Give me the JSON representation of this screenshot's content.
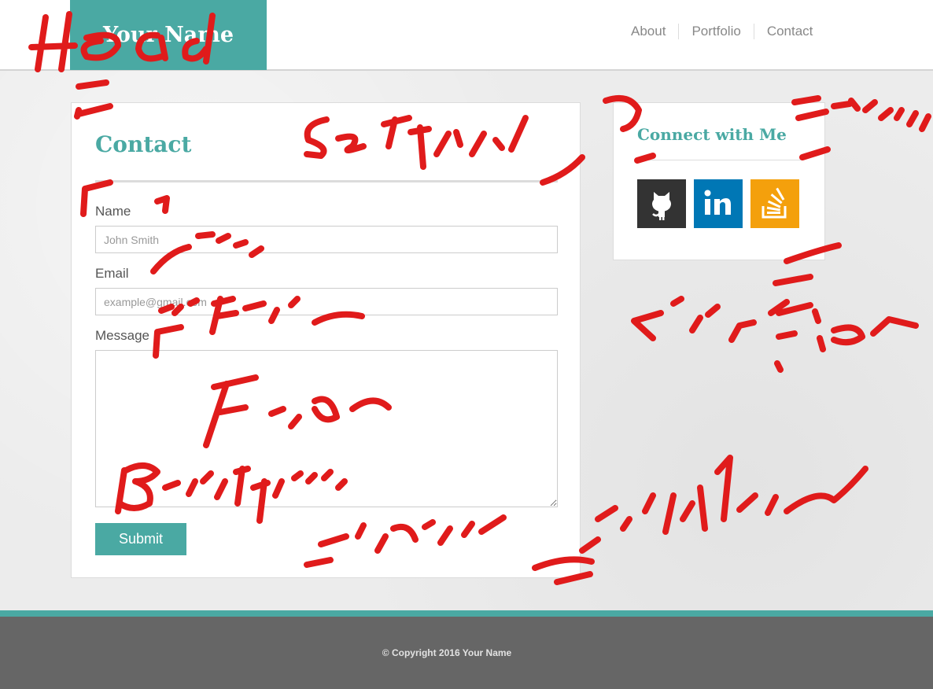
{
  "header": {
    "brand": "Your Name",
    "nav": [
      "About",
      "Portfolio",
      "Contact"
    ]
  },
  "contact": {
    "title": "Contact",
    "name_label": "Name",
    "name_placeholder": "John Smith",
    "email_label": "Email",
    "email_placeholder": "example@gmail.com",
    "message_label": "Message",
    "submit_label": "Submit"
  },
  "connect": {
    "title": "Connect with Me",
    "icons": [
      "github-icon",
      "linkedin-icon",
      "stackoverflow-icon"
    ]
  },
  "footer": {
    "copyright": "© Copyright 2016 Your Name"
  },
  "colors": {
    "accent": "#4aa9a3",
    "footer": "#666666",
    "annotation": "#e01b1b",
    "github": "#333333",
    "linkedin": "#0077b5",
    "stackoverflow": "#f4a00c"
  }
}
